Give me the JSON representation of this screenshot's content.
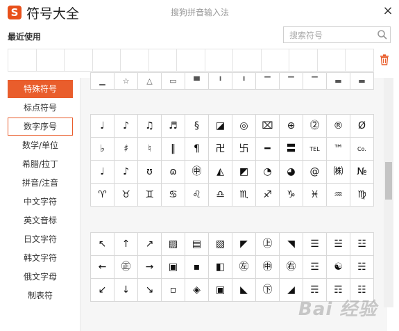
{
  "window": {
    "logo_letter": "S",
    "title": "符号大全",
    "ime_name": "搜狗拼音输入法",
    "close_symbol": "×"
  },
  "recent": {
    "label": "最近使用",
    "slots": 13
  },
  "search": {
    "placeholder": "搜索符号"
  },
  "sidebar": {
    "items": [
      {
        "label": "特殊符号",
        "state": "active"
      },
      {
        "label": "标点符号",
        "state": "normal"
      },
      {
        "label": "数字序号",
        "state": "hover"
      },
      {
        "label": "数学/单位",
        "state": "normal"
      },
      {
        "label": "希腊/拉丁",
        "state": "normal"
      },
      {
        "label": "拼音/注音",
        "state": "normal"
      },
      {
        "label": "中文字符",
        "state": "normal"
      },
      {
        "label": "英文音标",
        "state": "normal"
      },
      {
        "label": "日文字符",
        "state": "normal"
      },
      {
        "label": "韩文字符",
        "state": "normal"
      },
      {
        "label": "俄文字母",
        "state": "normal"
      },
      {
        "label": "制表符",
        "state": "normal"
      }
    ]
  },
  "symbols": {
    "partial_row": [
      "▁",
      "☆",
      "△",
      "▭",
      "▀",
      "╹",
      "╹",
      "▔",
      "▔",
      "▔",
      "▬",
      "▬"
    ],
    "block2": [
      [
        "♩",
        "♪",
        "♫",
        "♬",
        "§",
        "◪",
        "◎",
        "⌧",
        "⊕",
        "⓶",
        "®",
        "Ø"
      ],
      [
        "♭",
        "♯",
        "♮",
        "‖",
        "¶",
        "卍",
        "卐",
        "━",
        "〓",
        "TEL",
        "™",
        "Co."
      ],
      [
        "♩",
        "♪",
        "ʊ",
        "ɷ",
        "㊥",
        "◭",
        "◩",
        "◔",
        "◕",
        "@",
        "㈱",
        "№"
      ],
      [
        "♈",
        "♉",
        "♊",
        "♋",
        "♌",
        "♎",
        "♏",
        "♐",
        "♑",
        "♓",
        "♒",
        "♍"
      ]
    ],
    "block3": [
      [
        "↖",
        "↑",
        "↗",
        "▨",
        "▤",
        "▧",
        "◤",
        "㊤",
        "◥",
        "☰",
        "☱",
        "☳"
      ],
      [
        "←",
        "㊣",
        "→",
        "▣",
        "▪",
        "◧",
        "㊧",
        "㊥",
        "㊨",
        "☲",
        "☯",
        "☵"
      ],
      [
        "↙",
        "↓",
        "↘",
        "▫",
        "◈",
        "▣",
        "◣",
        "㊦",
        "◢",
        "☴",
        "☶",
        "☷"
      ]
    ]
  },
  "watermark": "Bai 经验",
  "colors": {
    "accent": "#e95d2c",
    "logo": "#e8501a",
    "grid_border": "#d8d8d8"
  }
}
